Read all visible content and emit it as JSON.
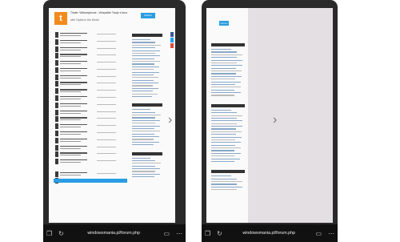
{
  "left_phone": {
    "ad": {
      "logo_letter": "t",
      "title": "Tinder: Widowsphone - Wszystkie Twoje e-kurs",
      "subtitle": "with Toplist in the World",
      "button": "Zobacz"
    },
    "url": "windowsmania.pl/forum.php"
  },
  "right_phone": {
    "url": "windowsmania.pl/forum.php",
    "button": "Forum"
  },
  "icons": {
    "copy": "copy-icon",
    "refresh": "refresh-icon",
    "book": "reading-view-icon",
    "menu": "more-icon",
    "next": "chevron-right-icon"
  },
  "colors": {
    "accent": "#2a9de3",
    "ad_logo": "#f28a1c",
    "frame": "#2a2a2a"
  }
}
